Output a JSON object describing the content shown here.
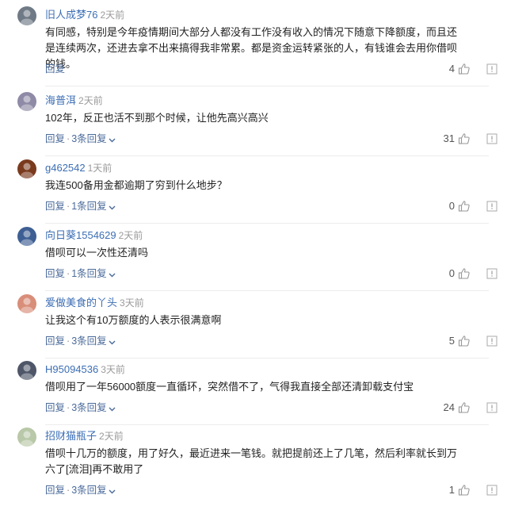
{
  "comments": [
    {
      "username": "旧人成梦76",
      "time": "2天前",
      "text": "有同感，特别是今年疫情期间大部分人都没有工作没有收入的情况下随意下降额度，而且还是连续两次，还进去拿不出来搞得我非常累。都是资金运转紧张的人，有钱谁会去用你借呗的钱。",
      "reply_label": "回复",
      "reply_count": "",
      "likes": "4",
      "avatar_color": "#6f7a86"
    },
    {
      "username": "海普洱",
      "time": "2天前",
      "text": "102年，反正也活不到那个时候，让他先高兴高兴",
      "reply_label": "回复",
      "reply_count": "3条回复",
      "likes": "31",
      "avatar_color": "#8f8aa6"
    },
    {
      "username": "g462542",
      "time": "1天前",
      "text": "我连500备用金都逾期了穷到什么地步？",
      "reply_label": "回复",
      "reply_count": "1条回复",
      "likes": "0",
      "avatar_color": "#7a3a1e"
    },
    {
      "username": "向日葵1554629",
      "time": "2天前",
      "text": "借呗可以一次性还清吗",
      "reply_label": "回复",
      "reply_count": "1条回复",
      "likes": "0",
      "avatar_color": "#3e5f93"
    },
    {
      "username": "爱做美食的丫头",
      "time": "3天前",
      "text": "让我这个有10万额度的人表示很满意啊",
      "reply_label": "回复",
      "reply_count": "3条回复",
      "likes": "5",
      "avatar_color": "#d98e7a"
    },
    {
      "username": "H95094536",
      "time": "3天前",
      "text": "借呗用了一年56000额度一直循环，突然借不了，气得我直接全部还清卸载支付宝",
      "reply_label": "回复",
      "reply_count": "3条回复",
      "likes": "24",
      "avatar_color": "#4e5668"
    },
    {
      "username": "招财猫瓶子",
      "time": "2天前",
      "text": "借呗十几万的额度，用了好久，最近进来一笔钱。就把提前还上了几笔，然后利率就长到万六了[流泪]再不敢用了",
      "reply_label": "回复",
      "reply_count": "3条回复",
      "likes": "1",
      "avatar_color": "#b8c8a8"
    }
  ],
  "colors": {
    "username": "#3c6eb4",
    "action": "#4a6a9a",
    "divider": "#ececec"
  },
  "icons": {
    "like": "thumbs-up-icon",
    "report": "report-icon",
    "expand": "chevron-down-icon"
  }
}
